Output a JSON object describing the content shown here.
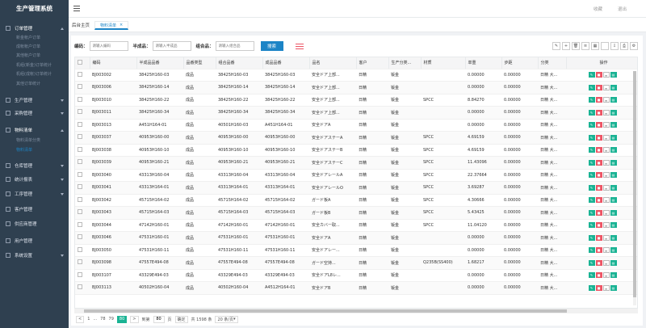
{
  "app": {
    "title": "生产管理系统"
  },
  "header": {
    "link1": "收藏",
    "link2": "退出"
  },
  "sidebar": {
    "items": [
      {
        "label": "订单管理",
        "open": true
      },
      {
        "label": "新金帐户订单",
        "sub": true
      },
      {
        "label": "成帐帐户订单",
        "sub": true
      },
      {
        "label": "其他帐户订单",
        "sub": true
      },
      {
        "label": "机组(新金)订单统计",
        "sub": true
      },
      {
        "label": "机组(成帐)订单统计",
        "sub": true
      },
      {
        "label": "其他订单统计",
        "sub": true
      },
      {
        "label": "生产管理",
        "open": false
      },
      {
        "label": "采购管理",
        "open": false
      },
      {
        "label": "物料清单",
        "open": true
      },
      {
        "label": "物料清单分类",
        "sub": true
      },
      {
        "label": "物料清单",
        "sub": true,
        "active": true
      },
      {
        "label": "仓库管理",
        "open": false
      },
      {
        "label": "统计报表",
        "open": false
      },
      {
        "label": "工序管理",
        "open": false
      },
      {
        "label": "客户管理"
      },
      {
        "label": "供应商管理"
      },
      {
        "label": "用户管理"
      },
      {
        "label": "系统设置",
        "open": false
      }
    ]
  },
  "tabs": {
    "home": "后台主页",
    "active": "物料清单"
  },
  "search": {
    "code_label": "编码：",
    "code_placeholder": "请输入编码",
    "semi_label": "半成品：",
    "semi_placeholder": "请输入半成品",
    "combo_label": "组合品：",
    "combo_placeholder": "请输入组合品",
    "button": "搜索"
  },
  "table": {
    "headers": [
      "编码",
      "半成品品番",
      "品番类型",
      "组合品番",
      "成品品番",
      "品名",
      "客户",
      "生产分类...",
      "材质",
      "单重",
      "步距",
      "分类",
      "操作"
    ],
    "rows": [
      [
        "BJ003002",
        "38425H160-03",
        "成品",
        "38425H160-03",
        "38425H160-03",
        "安全ドア上部...",
        "日精",
        "钣金",
        "",
        "0.00000",
        "0.00000",
        "日精 大..."
      ],
      [
        "BJ003006",
        "38425H160-14",
        "成品",
        "38425H160-14",
        "38425H160-14",
        "安全ドア上部...",
        "日精",
        "钣金",
        "",
        "0.00000",
        "0.00000",
        "日精 大..."
      ],
      [
        "BJ003010",
        "38425H160-22",
        "成品",
        "38425H160-22",
        "38425H160-22",
        "安全ドア上部...",
        "日精",
        "钣金",
        "SPCC",
        "8.84270",
        "0.00000",
        "日精 大..."
      ],
      [
        "BJ003011",
        "38425H160-34",
        "成品",
        "38425H160-34",
        "38425H160-34",
        "安全ドア上部...",
        "日精",
        "钣金",
        "",
        "0.00000",
        "0.00000",
        "日精 大..."
      ],
      [
        "BJ003013",
        "A451H164-01",
        "成品",
        "40501H160-03",
        "A451H164-01",
        "安全ドアA",
        "日精",
        "钣金",
        "",
        "0.00000",
        "0.00000",
        "日精 大..."
      ],
      [
        "BJ003037",
        "40953H160-00",
        "成品",
        "40953H160-00",
        "40953H160-00",
        "安全ドアステーA",
        "日精",
        "钣金",
        "SPCC",
        "4.69159",
        "0.00000",
        "日精 大..."
      ],
      [
        "BJ003038",
        "40953H160-10",
        "成品",
        "40953H160-10",
        "40953H160-10",
        "安全ドアステーB",
        "日精",
        "钣金",
        "SPCC",
        "4.69159",
        "0.00000",
        "日精 大..."
      ],
      [
        "BJ003039",
        "40953H160-21",
        "成品",
        "40953H160-21",
        "40953H160-21",
        "安全ドアステーC",
        "日精",
        "钣金",
        "SPCC",
        "11.43096",
        "0.00000",
        "日精 大..."
      ],
      [
        "BJ003040",
        "43313H160-04",
        "成品",
        "43313H160-04",
        "43313H160-04",
        "安全ドアレールA",
        "日精",
        "钣金",
        "SPCC",
        "22.37664",
        "0.00000",
        "日精 大..."
      ],
      [
        "BJ003041",
        "43313H164-01",
        "成品",
        "43313H164-01",
        "43313H164-01",
        "安全ドアレールO",
        "日精",
        "钣金",
        "SPCC",
        "3.69287",
        "0.00000",
        "日精 大..."
      ],
      [
        "BJ003042",
        "45715H164-02",
        "成品",
        "45715H164-02",
        "45715H164-02",
        "ガード板A",
        "日精",
        "钣金",
        "SPCC",
        "4.30666",
        "0.00000",
        "日精 大..."
      ],
      [
        "BJ003043",
        "45715H164-03",
        "成品",
        "45715H164-03",
        "45715H164-03",
        "ガード板B",
        "日精",
        "钣金",
        "SPCC",
        "5.43425",
        "0.00000",
        "日精 大..."
      ],
      [
        "BJ003044",
        "47142H160-01",
        "成品",
        "47142H160-01",
        "47142H160-01",
        "安全カバー取...",
        "日精",
        "钣金",
        "SPCC",
        "11.04120",
        "0.00000",
        "日精 大..."
      ],
      [
        "BJ003046",
        "47531H160-01",
        "成品",
        "47531H160-01",
        "47531H160-01",
        "安全ドアA",
        "日精",
        "钣金",
        "",
        "0.00000",
        "0.00000",
        "日精 大..."
      ],
      [
        "BJ003050",
        "47531H160-11",
        "成品",
        "47531H160-11",
        "47531H160-11",
        "安全ドアレー...",
        "日精",
        "钣金",
        "",
        "0.00000",
        "0.00000",
        "日精 大..."
      ],
      [
        "BJ003098",
        "47557E494-08",
        "成品",
        "47557E494-08",
        "47557E494-08",
        "ガード空持...",
        "日精",
        "钣金",
        "Q235B(SS400)",
        "1.68217",
        "0.00000",
        "日精 大..."
      ],
      [
        "BJ003107",
        "43329E494-03",
        "成品",
        "43329E494-03",
        "43329E494-03",
        "安全ドアL8レ...",
        "日精",
        "钣金",
        "",
        "0.00000",
        "0.00000",
        "日精 大..."
      ],
      [
        "BJ003113",
        "40502H160-04",
        "成品",
        "40502H160-04",
        "A4512H164-01",
        "安全ドアB",
        "日精",
        "钣金",
        "",
        "0.00000",
        "0.00000",
        "日精 大..."
      ]
    ]
  },
  "pager": {
    "prev": "<",
    "p1": "1",
    "ellipsis": "...",
    "p78": "78",
    "p79": "79",
    "p80": "80",
    "next": ">",
    "goto_label": "到第",
    "goto_value": "80",
    "page_unit": "页",
    "confirm": "确定",
    "total": "共 1598 条",
    "per_page": "20 条/页"
  }
}
